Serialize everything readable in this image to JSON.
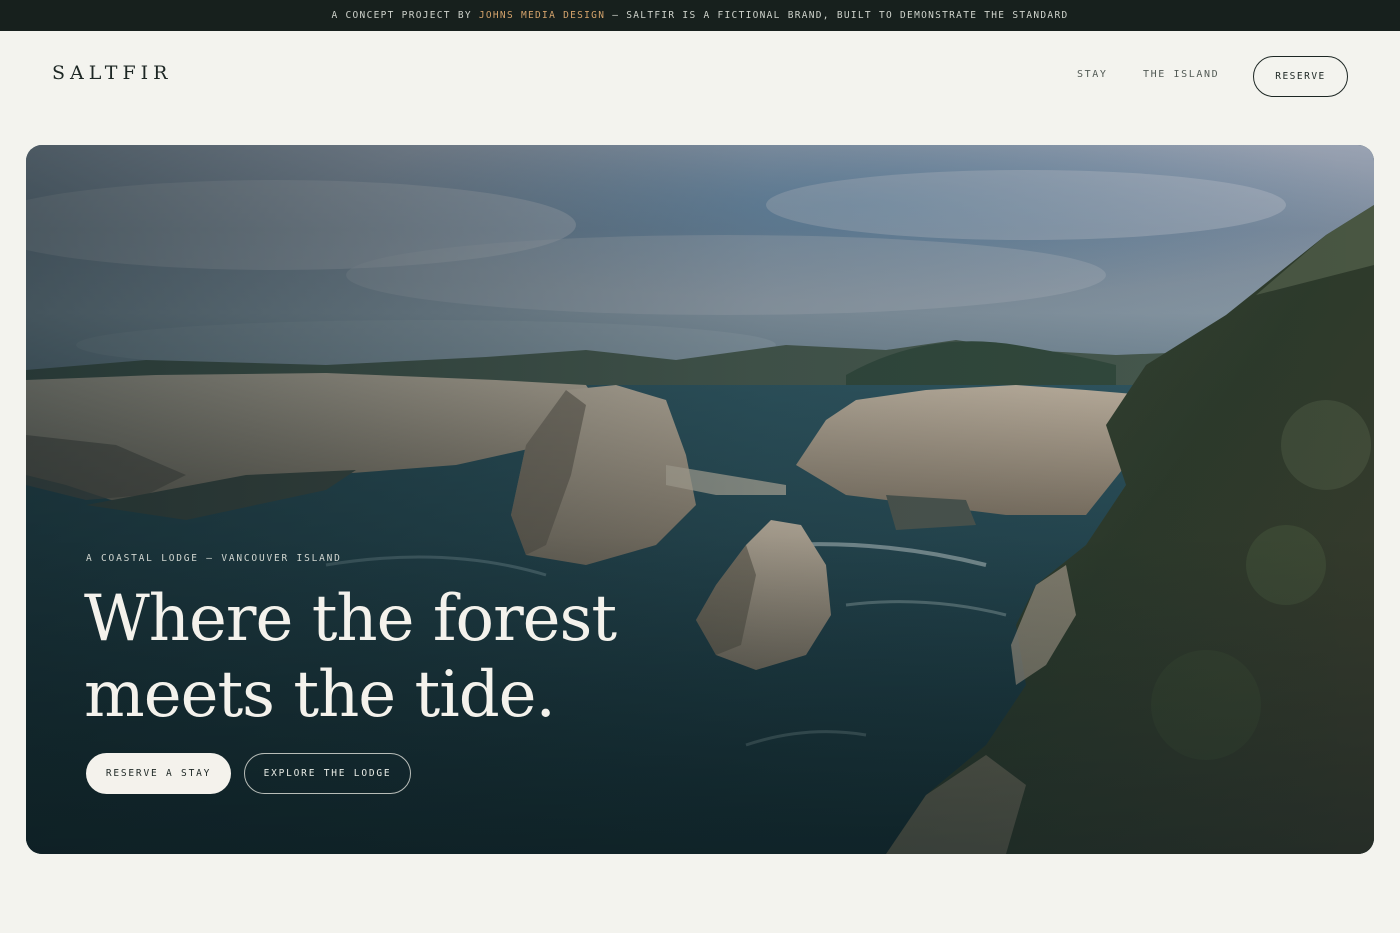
{
  "topbar": {
    "prefix": "A CONCEPT PROJECT BY",
    "studio": "JOHNS MEDIA DESIGN",
    "dash": "—",
    "suffix": "SALTFIR IS A FICTIONAL BRAND, BUILT TO DEMONSTRATE THE STANDARD"
  },
  "header": {
    "logo": "SALTFIR",
    "nav": [
      "STAY",
      "THE ISLAND"
    ],
    "cta": "RESERVE"
  },
  "hero": {
    "eyebrow": "A COASTAL LODGE — VANCOUVER ISLAND",
    "headline_line1": "Where the forest",
    "headline_line2": "meets the tide.",
    "primary_cta": "RESERVE A STAY",
    "secondary_cta": "EXPLORE THE LODGE"
  },
  "colors": {
    "background": "#f3f3ee",
    "topbar": "#17201d",
    "accent": "#d3a26b",
    "ink": "#1d2724",
    "hero_text": "#f4f2ec"
  }
}
